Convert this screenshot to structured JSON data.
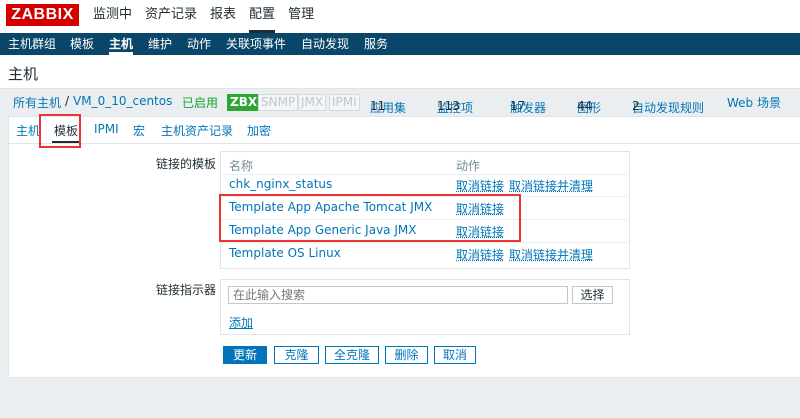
{
  "topbar": {
    "logo": "ZABBIX",
    "items": [
      "监测中",
      "资产记录",
      "报表",
      "配置",
      "管理"
    ],
    "active_index": 3
  },
  "subnav": {
    "items": [
      "主机群组",
      "模板",
      "主机",
      "维护",
      "动作",
      "关联项事件",
      "自动发现",
      "服务"
    ],
    "active_index": 2
  },
  "page": {
    "title": "主机"
  },
  "breadcrumbs": {
    "all_hosts": "所有主机",
    "separator": "/",
    "host": "VM_0_10_centos",
    "status": "已启用",
    "availability": [
      "ZBX",
      "SNMP",
      "JMX",
      "IPMI"
    ],
    "links": [
      {
        "label": "应用集",
        "count": "11"
      },
      {
        "label": "监控项",
        "count": "113"
      },
      {
        "label": "触发器",
        "count": "17"
      },
      {
        "label": "图形",
        "count": "44"
      },
      {
        "label": "自动发现规则",
        "count": "2"
      },
      {
        "label": "Web 场景",
        "count": ""
      }
    ]
  },
  "tabs": {
    "items": [
      "主机",
      "模板",
      "IPMI",
      "宏",
      "主机资产记录",
      "加密"
    ],
    "active_index": 1
  },
  "form": {
    "linked_templates_label": "链接的模板",
    "col_name": "名称",
    "col_action": "动作",
    "templates": [
      {
        "name": "chk_nginx_status",
        "unlink": "取消链接",
        "unlink_clear": "取消链接并清理"
      },
      {
        "name": "Template App Apache Tomcat JMX",
        "unlink": "取消链接",
        "unlink_clear": ""
      },
      {
        "name": "Template App Generic Java JMX",
        "unlink": "取消链接",
        "unlink_clear": ""
      },
      {
        "name": "Template OS Linux",
        "unlink": "取消链接",
        "unlink_clear": "取消链接并清理"
      }
    ],
    "link_indicator_label": "链接指示器",
    "search_placeholder": "在此输入搜索",
    "select_button": "选择",
    "add_link": "添加"
  },
  "buttons": {
    "update": "更新",
    "clone": "克隆",
    "full_clone": "全克隆",
    "delete": "删除",
    "cancel": "取消"
  },
  "colors": {
    "logo": "#d40000",
    "subnav": "#0a466a",
    "link": "#0275b8",
    "enabled": "#1ba12e",
    "zbx_badge": "#2fa634",
    "highlight": "#e33333"
  }
}
